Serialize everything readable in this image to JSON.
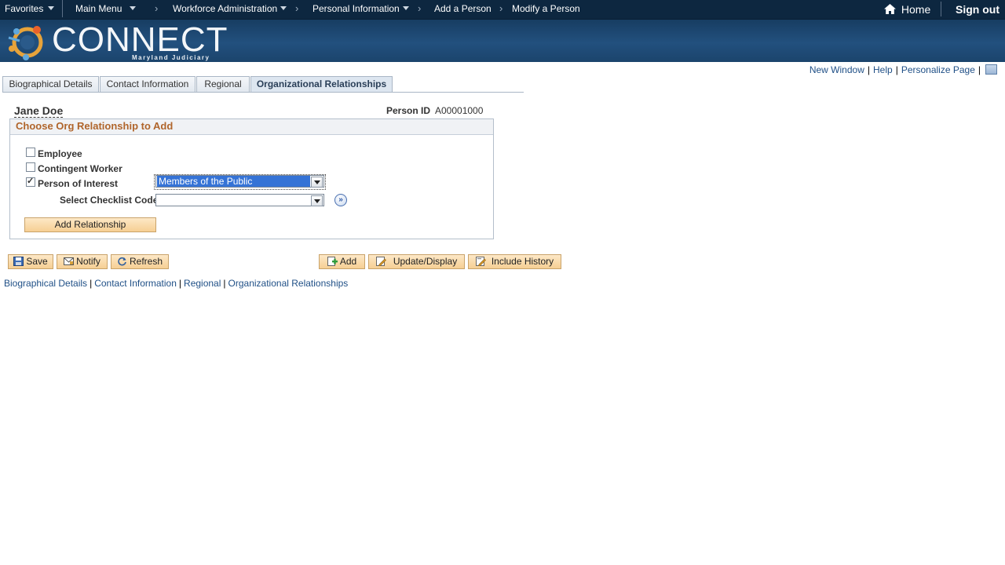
{
  "topnav": {
    "favorites": "Favorites",
    "main_menu": "Main Menu",
    "crumb_1": "Workforce Administration",
    "crumb_2": "Personal Information",
    "crumb_3": "Add a Person",
    "crumb_4": "Modify a Person",
    "home": "Home",
    "sign_out": "Sign out"
  },
  "banner": {
    "logo_text": "CONNECT",
    "logo_sub": "Maryland Judiciary"
  },
  "utility": {
    "new_window": "New Window",
    "help": "Help",
    "personalize": "Personalize Page"
  },
  "tabs": [
    {
      "label": "Biographical Details",
      "active": false
    },
    {
      "label": "Contact Information",
      "active": false
    },
    {
      "label": "Regional",
      "active": false
    },
    {
      "label": "Organizational Relationships",
      "active": true
    }
  ],
  "person": {
    "name": "Jane Doe",
    "id_label": "Person ID",
    "id_value": "A00001000"
  },
  "group": {
    "title": "Choose Org Relationship to Add",
    "employee_label": "Employee",
    "employee_checked": false,
    "contingent_label": "Contingent Worker",
    "contingent_checked": false,
    "poi_label": "Person of Interest",
    "poi_checked": true,
    "poi_type_value": "Members of the Public",
    "checklist_label": "Select Checklist Code",
    "checklist_value": "",
    "add_relationship": "Add Relationship"
  },
  "toolbar": {
    "save": "Save",
    "notify": "Notify",
    "refresh": "Refresh",
    "add": "Add",
    "update_display": "Update/Display",
    "include_history": "Include History"
  },
  "bottom_links": [
    "Biographical Details",
    "Contact Information",
    "Regional",
    "Organizational Relationships"
  ],
  "colors": {
    "topbar": "#0d2740",
    "banner": "#22507e",
    "link": "#1f4f86",
    "group_title": "#b0652b",
    "button": "#f6cf93"
  }
}
